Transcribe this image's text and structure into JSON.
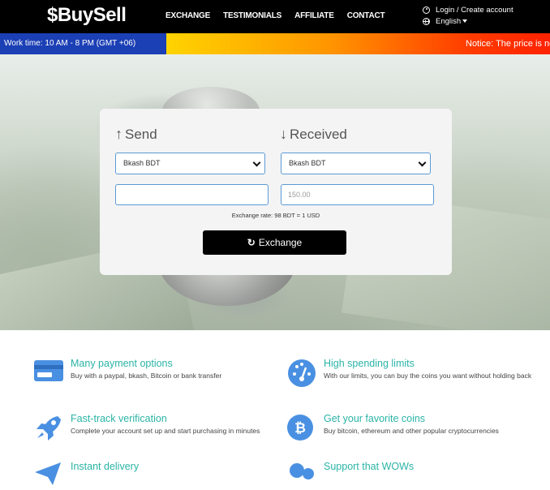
{
  "header": {
    "logo": "$BuySell",
    "nav": [
      "EXCHANGE",
      "TESTIMONIALS",
      "AFFILIATE",
      "CONTACT"
    ],
    "login_label": "Login / Create account",
    "language_label": "English"
  },
  "infobar": {
    "work_time": "Work time: 10 AM - 8 PM (GMT +06)",
    "notice": "Notice: The price is no"
  },
  "exchange": {
    "send_title": "Send",
    "received_title": "Received",
    "send_method": "Bkash BDT",
    "received_method": "Bkash BDT",
    "send_amount": "",
    "received_amount_placeholder": "150.00",
    "rate_text": "Exchange rate: 98 BDT = 1 USD",
    "button_label": "Exchange"
  },
  "features": [
    {
      "icon": "credit-card-icon",
      "title": "Many payment options",
      "desc": "Buy with a paypal, bkash, Bitcoin or bank transfer"
    },
    {
      "icon": "speedometer-icon",
      "title": "High spending limits",
      "desc": "With our limits, you can buy the coins you want without holding back"
    },
    {
      "icon": "rocket-icon",
      "title": "Fast-track verification",
      "desc": "Complete your account set up and start purchasing in minutes"
    },
    {
      "icon": "bitcoin-icon",
      "title": "Get your favorite coins",
      "desc": "Buy bitcoin, ethereum and other popular cryptocurrencies"
    },
    {
      "icon": "paper-plane-icon",
      "title": "Instant delivery",
      "desc": ""
    },
    {
      "icon": "gears-icon",
      "title": "Support that WOWs",
      "desc": ""
    }
  ],
  "colors": {
    "accent": "#2bb4a6",
    "icon_blue": "#4a90e2",
    "worktime_bg": "#1b3fb5",
    "header_bg": "#000000"
  }
}
